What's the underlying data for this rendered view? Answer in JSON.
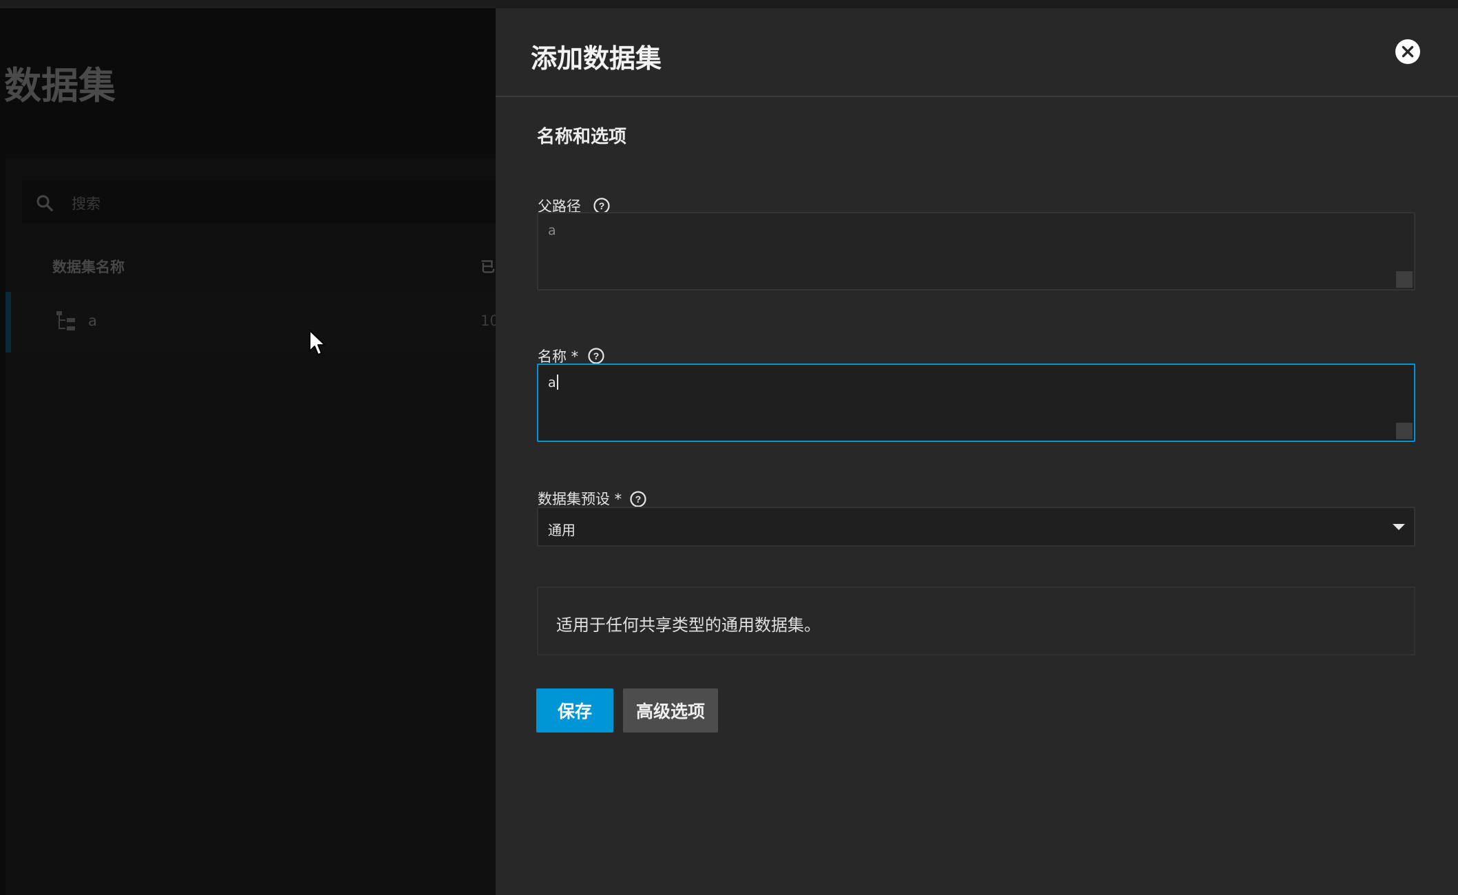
{
  "background": {
    "page_title": "数据集",
    "search": {
      "placeholder": "搜索"
    },
    "table": {
      "columns": [
        "数据集名称",
        "已"
      ],
      "rows": [
        {
          "name": "a",
          "used": "10"
        }
      ]
    }
  },
  "panel": {
    "title": "添加数据集",
    "section_title": "名称和选项",
    "fields": {
      "parent_path": {
        "label": "父路径",
        "value": "a"
      },
      "name": {
        "label": "名称 *",
        "value": "a"
      },
      "preset": {
        "label": "数据集预设 *",
        "value": "通用"
      }
    },
    "preset_description": "适用于任何共享类型的通用数据集。",
    "buttons": {
      "save": "保存",
      "advanced": "高级选项"
    }
  },
  "colors": {
    "accent": "#0095d5",
    "panel_bg": "#282828",
    "input_bg": "#1f1f1f",
    "secondary_button": "#4d4d4d"
  },
  "icons": [
    "search-icon",
    "dataset-tree-icon",
    "mouse-cursor-icon",
    "close-icon",
    "help-icon",
    "chevron-down-icon"
  ]
}
